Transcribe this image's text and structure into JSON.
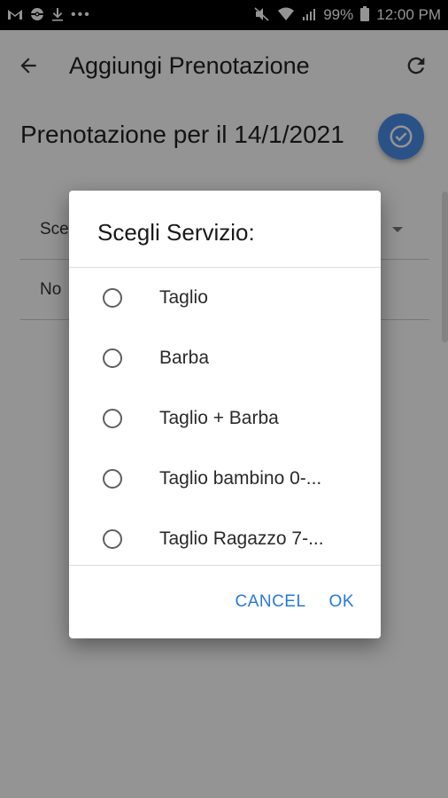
{
  "status_bar": {
    "left_icons": [
      "gmail-icon",
      "pokeball-icon",
      "download-icon"
    ],
    "more": "•••",
    "battery_percent": "99%",
    "time": "12:00 PM"
  },
  "app_bar": {
    "title": "Aggiungi Prenotazione"
  },
  "page": {
    "heading": "Prenotazione per il 14/1/2021",
    "field_service_partial": "Sce",
    "field_notes_partial": "No"
  },
  "dialog": {
    "title": "Scegli Servizio:",
    "options": [
      {
        "label": "Taglio",
        "selected": false
      },
      {
        "label": "Barba",
        "selected": false
      },
      {
        "label": "Taglio + Barba",
        "selected": false
      },
      {
        "label": "Taglio bambino 0-...",
        "selected": false
      },
      {
        "label": "Taglio Ragazzo 7-...",
        "selected": false
      }
    ],
    "cancel_label": "CANCEL",
    "ok_label": "OK"
  },
  "colors": {
    "accent": "#2979d6",
    "fab": "#4a8ee8",
    "scrim": "rgba(0,0,0,0.42)"
  }
}
